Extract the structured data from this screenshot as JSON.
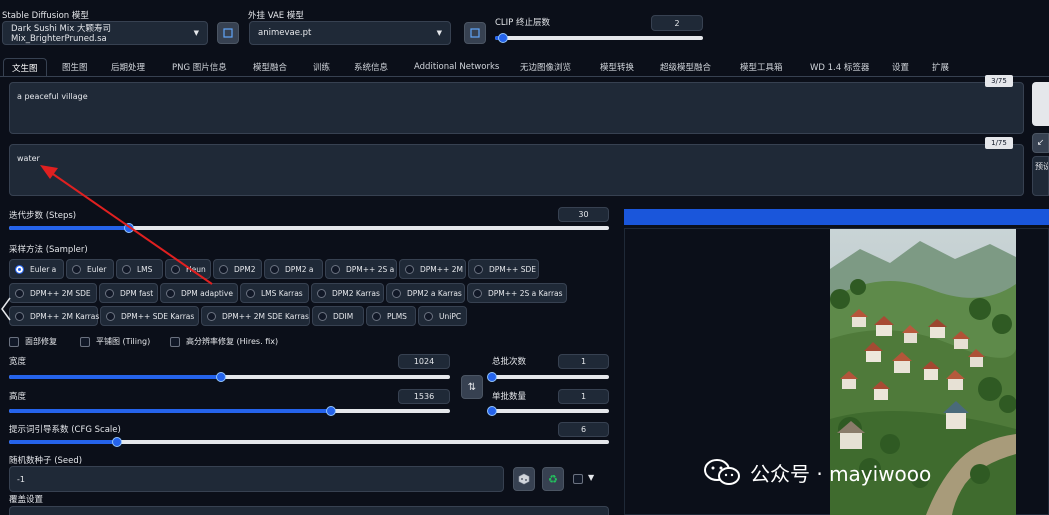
{
  "model": {
    "label": "Stable Diffusion 模型",
    "value": "Dark Sushi Mix 大颗寿司Mix_BrighterPruned.sa"
  },
  "vae": {
    "label": "外挂 VAE 模型",
    "value": "animevae.pt"
  },
  "clip": {
    "label": "CLIP 终止层数",
    "value": "2",
    "fraction": 0.04
  },
  "tabs": [
    "文生图",
    "图生图",
    "后期处理",
    "PNG 图片信息",
    "模型融合",
    "训练",
    "系统信息",
    "Additional Networks",
    "无边图像浏览",
    "模型转换",
    "超级模型融合",
    "模型工具箱",
    "WD 1.4 标签器",
    "设置",
    "扩展"
  ],
  "prompt": {
    "text": "a peaceful village",
    "counter": "3/75"
  },
  "negative": {
    "text": "water",
    "counter": "1/75"
  },
  "side_label": "预设",
  "steps": {
    "label": "迭代步数 (Steps)",
    "value": "30",
    "fraction": 0.2
  },
  "sampler": {
    "label": "采样方法 (Sampler)",
    "selected": "Euler a",
    "options": [
      "Euler a",
      "Euler",
      "LMS",
      "Heun",
      "DPM2",
      "DPM2 a",
      "DPM++ 2S a",
      "DPM++ 2M",
      "DPM++ SDE",
      "DPM++ 2M SDE",
      "DPM fast",
      "DPM adaptive",
      "LMS Karras",
      "DPM2 Karras",
      "DPM2 a Karras",
      "DPM++ 2S a Karras",
      "DPM++ 2M Karras",
      "DPM++ SDE Karras",
      "DPM++ 2M SDE Karras",
      "DDIM",
      "PLMS",
      "UniPC"
    ]
  },
  "checks": {
    "face": "面部修复",
    "tiling": "平铺图 (Tiling)",
    "hires": "高分辨率修复 (Hires. fix)"
  },
  "width": {
    "label": "宽度",
    "value": "1024",
    "fraction": 0.48
  },
  "height": {
    "label": "高度",
    "value": "1536",
    "fraction": 0.73
  },
  "batch_count": {
    "label": "总批次数",
    "value": "1",
    "fraction": 0.0
  },
  "batch_size": {
    "label": "单批数量",
    "value": "1",
    "fraction": 0.0
  },
  "cfg": {
    "label": "提示词引导系数 (CFG Scale)",
    "value": "6",
    "fraction": 0.18
  },
  "seed": {
    "label": "随机数种子 (Seed)",
    "value": "-1"
  },
  "override_label": "覆盖设置",
  "watermark": "公众号 · mayiwooo",
  "colors": {
    "bg": "#0b0f19",
    "panel": "#1f2937",
    "accent": "#2563eb",
    "arrow": "#e02020"
  }
}
